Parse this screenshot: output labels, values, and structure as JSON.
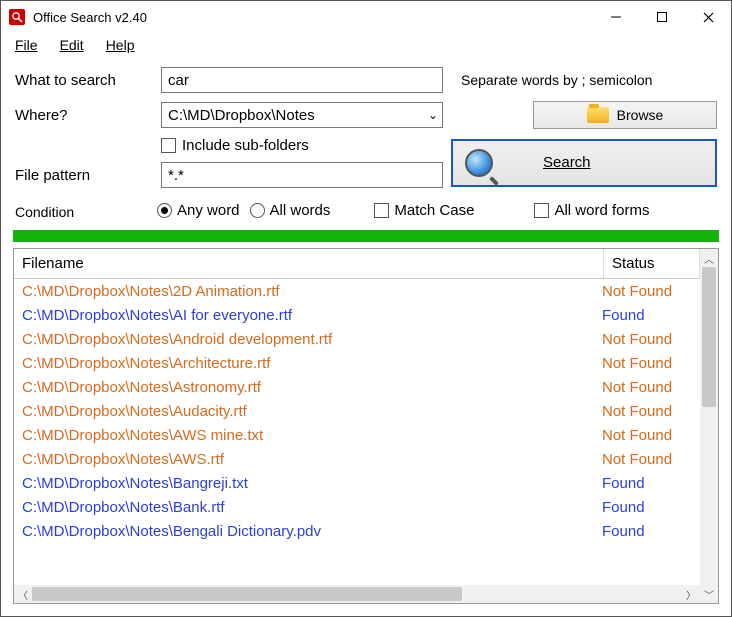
{
  "window": {
    "title": "Office Search v2.40"
  },
  "menu": {
    "file": "File",
    "edit": "Edit",
    "help": "Help"
  },
  "form": {
    "what_label": "What to search",
    "what_value": "car",
    "hint": "Separate words by ; semicolon",
    "where_label": "Where?",
    "where_value": "C:\\MD\\Dropbox\\Notes",
    "browse": "Browse",
    "include_sub": "Include sub-folders",
    "pattern_label": "File pattern",
    "pattern_value": "*.*",
    "search": "Search",
    "condition_label": "Condition",
    "any_word": "Any word",
    "all_words": "All words",
    "match_case": "Match Case",
    "all_forms": "All word forms"
  },
  "table": {
    "col_filename": "Filename",
    "col_status": "Status",
    "rows": [
      {
        "file": "C:\\MD\\Dropbox\\Notes\\2D Animation.rtf",
        "status": "Not Found",
        "ok": false
      },
      {
        "file": "C:\\MD\\Dropbox\\Notes\\AI for everyone.rtf",
        "status": "Found",
        "ok": true
      },
      {
        "file": "C:\\MD\\Dropbox\\Notes\\Android development.rtf",
        "status": "Not Found",
        "ok": false
      },
      {
        "file": "C:\\MD\\Dropbox\\Notes\\Architecture.rtf",
        "status": "Not Found",
        "ok": false
      },
      {
        "file": "C:\\MD\\Dropbox\\Notes\\Astronomy.rtf",
        "status": "Not Found",
        "ok": false
      },
      {
        "file": "C:\\MD\\Dropbox\\Notes\\Audacity.rtf",
        "status": "Not Found",
        "ok": false
      },
      {
        "file": "C:\\MD\\Dropbox\\Notes\\AWS mine.txt",
        "status": "Not Found",
        "ok": false
      },
      {
        "file": "C:\\MD\\Dropbox\\Notes\\AWS.rtf",
        "status": "Not Found",
        "ok": false
      },
      {
        "file": "C:\\MD\\Dropbox\\Notes\\Bangreji.txt",
        "status": "Found",
        "ok": true
      },
      {
        "file": "C:\\MD\\Dropbox\\Notes\\Bank.rtf",
        "status": "Found",
        "ok": true
      },
      {
        "file": "C:\\MD\\Dropbox\\Notes\\Bengali Dictionary.pdv",
        "status": "Found",
        "ok": true
      }
    ]
  }
}
